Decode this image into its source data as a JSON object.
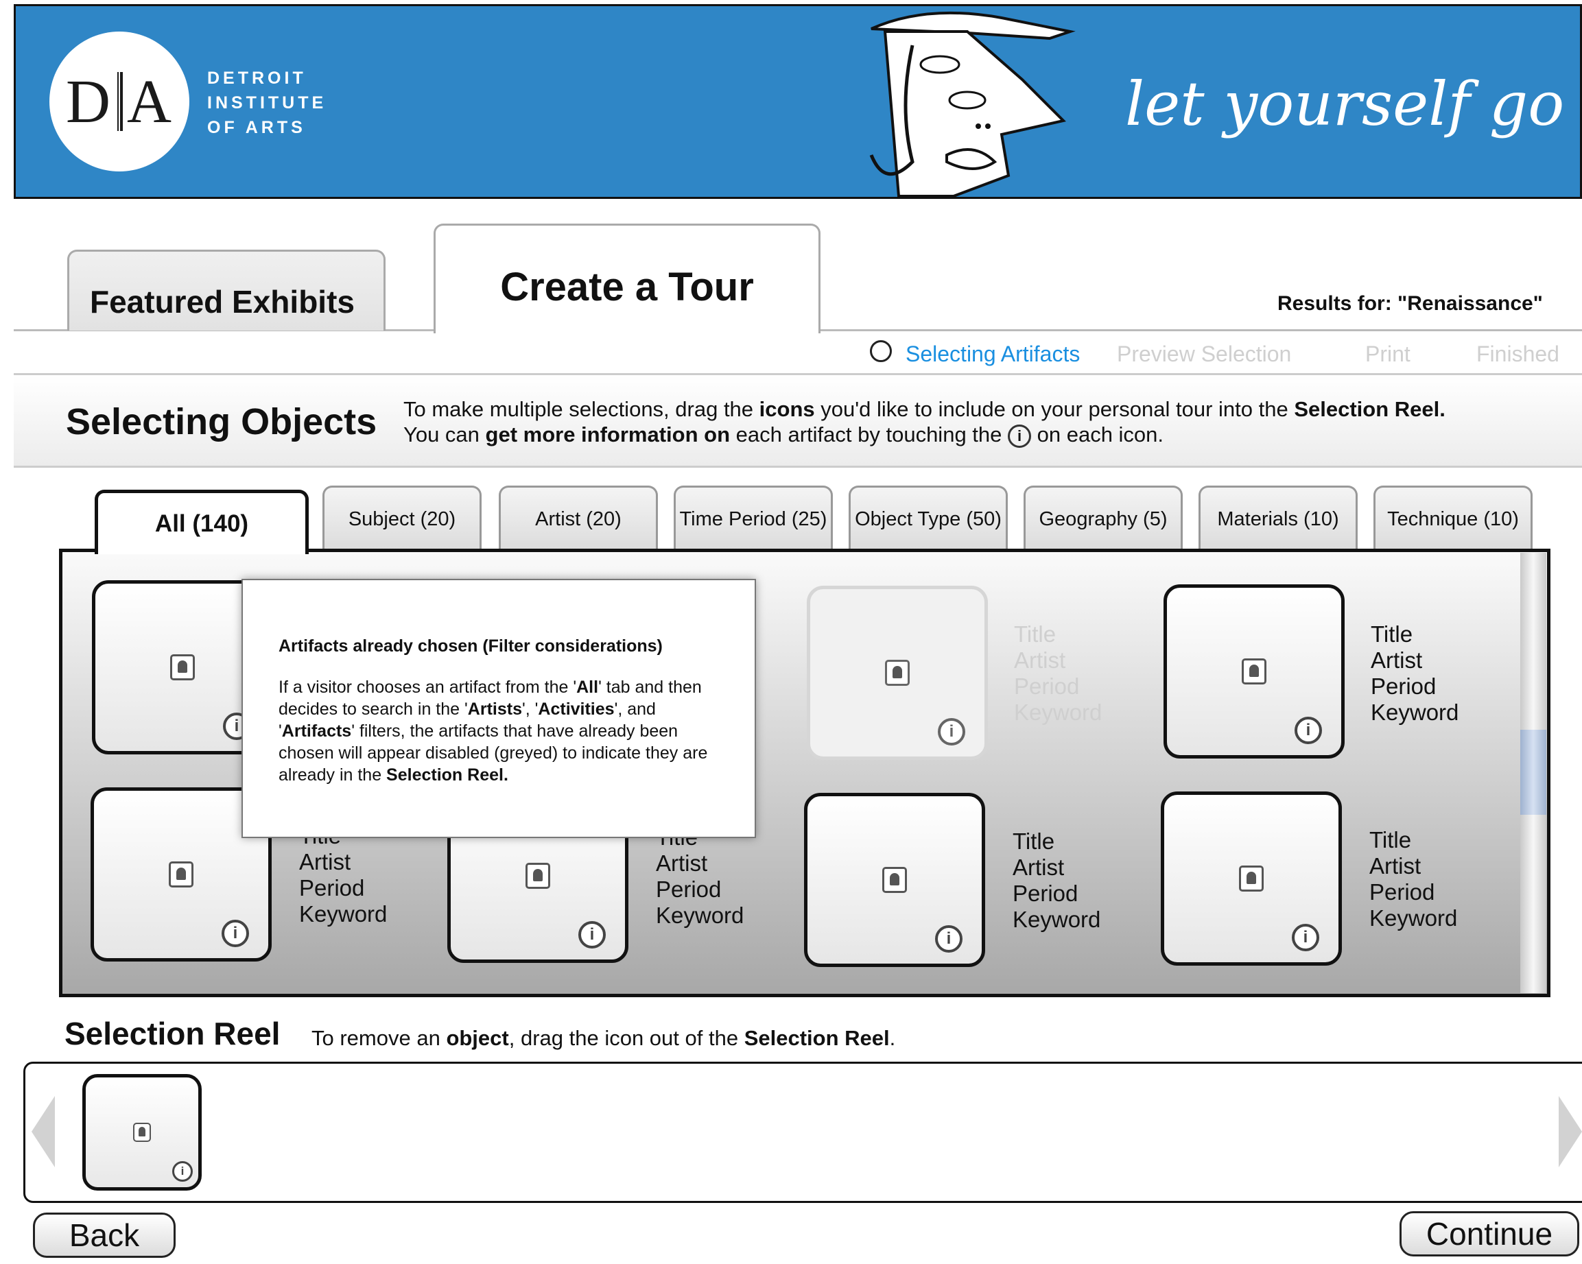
{
  "header": {
    "logo_mark": "D|A",
    "logo_lines": [
      "DETROIT",
      "INSTITUTE",
      "OF ARTS"
    ],
    "tagline": "let yourself go",
    "bg_color": "#2f86c6"
  },
  "tabs": {
    "featured": "Featured Exhibits",
    "create": "Create a Tour"
  },
  "results": "Results for: \"Renaissance\"",
  "steps": [
    "Selecting Artifacts",
    "Preview Selection",
    "Print",
    "Finished"
  ],
  "instructions": {
    "title": "Selecting Objects",
    "line1_a": "To make multiple selections, drag the ",
    "line1_b": "icons",
    "line1_c": " you'd like to include on your personal tour into the ",
    "line1_d": "Selection Reel.",
    "line2_a": "You can ",
    "line2_b": "get more information on",
    "line2_c": " each artifact by touching the ",
    "line2_d": " on each icon."
  },
  "filters": {
    "all": "All  (140)",
    "subject": "Subject (20)",
    "artist": "Artist (20)",
    "time_period": "Time Period (25)",
    "object_type": "Object Type (50)",
    "geography": "Geography (5)",
    "materials": "Materials (10)",
    "technique": "Technique (10)"
  },
  "artifact_meta": [
    "Title",
    "Artist",
    "Period",
    "Keyword"
  ],
  "row2_meta": [
    "Artist",
    "Period",
    "Keyword"
  ],
  "tooltip": {
    "title": "Artifacts already chosen (Filter considerations)",
    "p1": "If a visitor chooses an artifact from the '",
    "b_all": "All",
    "p2": "' tab and then decides to search in the '",
    "b_artists": "Artists",
    "p3": "', '",
    "b_activities": "Activities",
    "p4": "', and '",
    "b_artifacts": "Artifacts",
    "p5": "' filters, the artifacts that have already been chosen will appear disabled (greyed) to indicate they are already in the ",
    "b_reel": "Selection Reel."
  },
  "reel": {
    "title": "Selection Reel",
    "text_a": "To remove an ",
    "text_b": "object",
    "text_c": ", drag the icon out of the ",
    "text_d": "Selection Reel",
    "text_e": "."
  },
  "buttons": {
    "back": "Back",
    "continue": "Continue"
  },
  "icons": {
    "artifact": "artifact-image-icon",
    "info": "info-icon"
  },
  "colors": {
    "active_step": "#1a8fe0",
    "inactive_step": "#cfcfcf"
  }
}
